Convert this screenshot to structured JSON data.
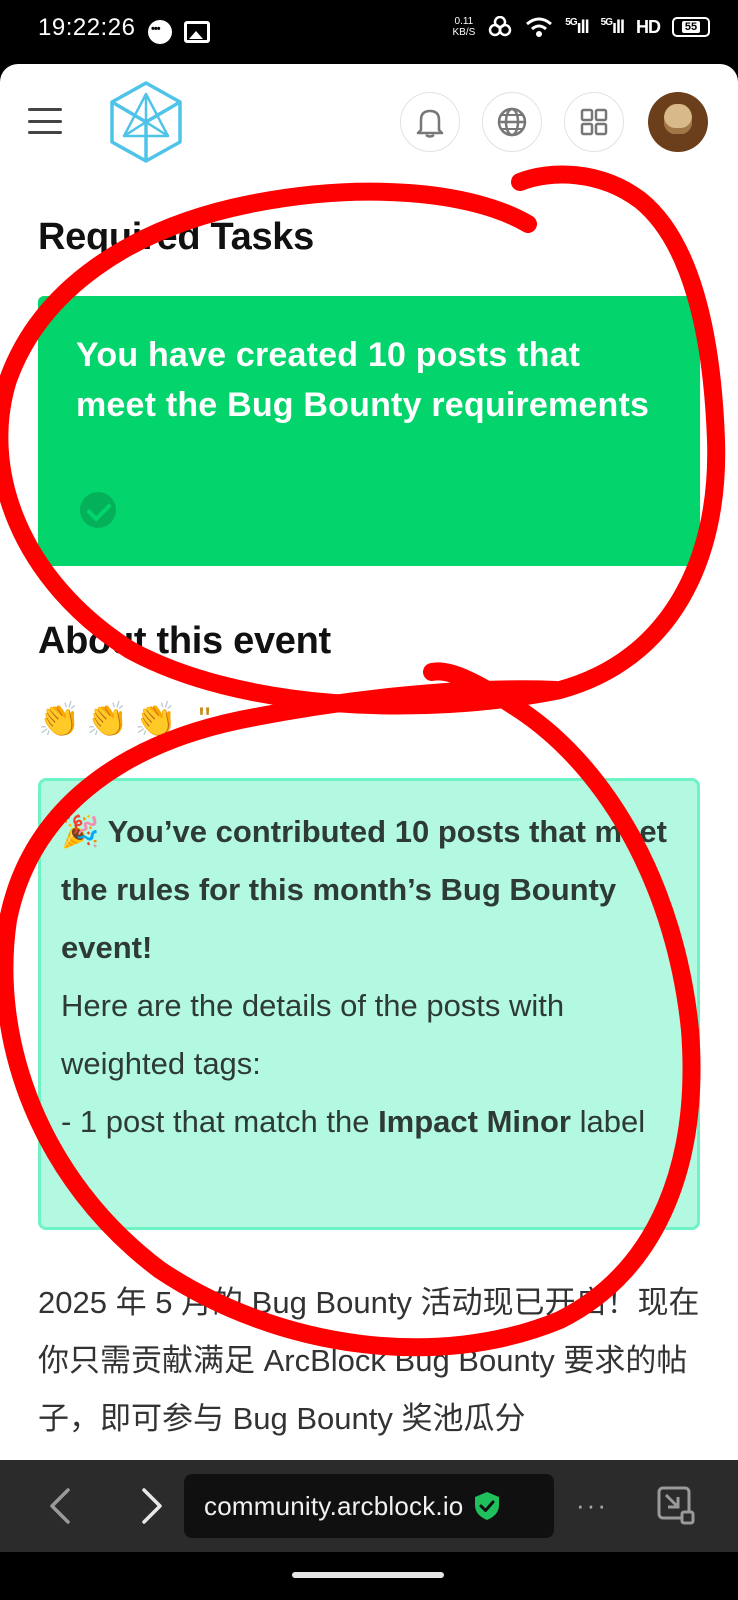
{
  "status_bar": {
    "time": "19:22:26",
    "net_speed_value": "0.11",
    "net_speed_unit": "KB/S",
    "signal1": "5G",
    "signal2": "5G",
    "hd": "HD",
    "battery": "55"
  },
  "header": {
    "menu_icon": "hamburger-menu-icon",
    "logo_icon": "arcblock-cube-logo",
    "icons": [
      "bell-icon",
      "globe-icon",
      "apps-grid-icon"
    ],
    "avatar": "user-avatar"
  },
  "required_tasks": {
    "title": "Required Tasks",
    "card_text": "You have created 10 posts that meet the Bug Bounty requirements",
    "status_icon": "check-circle-icon",
    "card_color": "#04d46c"
  },
  "about": {
    "title": "About this event",
    "clap_row": "👏👏👏 \""
  },
  "bounty_card": {
    "headline_emoji": "🎉",
    "headline": "You’ve contributed 10 posts that meet the rules for this month’s Bug Bounty event!",
    "details_intro": "Here are the details of the posts with weighted tags:",
    "detail_prefix": "- 1 post that match the ",
    "detail_bold": "Impact Minor",
    "detail_suffix": " label",
    "card_color": "#b3f9e1",
    "border_color": "#6ff2c4"
  },
  "body_text": "2025 年 5 月的 Bug Bounty 活动现已开启！现在你只需贡献满足 ArcBlock Bug Bounty 要求的帖子，即可参与 Bug Bounty 奖池瓜分",
  "browser": {
    "url": "community.arcblock.io",
    "secure_icon": "shield-check-icon",
    "back_icon": "back-arrow-icon",
    "forward_icon": "forward-arrow-icon",
    "more_label": "···",
    "tabs_icon": "tabs-icon"
  },
  "annotation": {
    "color": "#ff0000"
  }
}
